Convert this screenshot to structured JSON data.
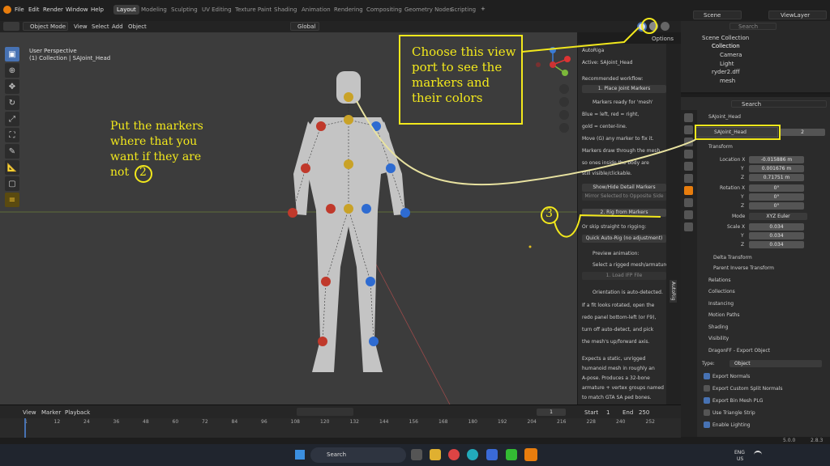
{
  "topbar": {
    "menus": [
      "File",
      "Edit",
      "Render",
      "Window",
      "Help"
    ],
    "workspaces": [
      "Layout",
      "Modeling",
      "Sculpting",
      "UV Editing",
      "Texture Paint",
      "Shading",
      "Animation",
      "Rendering",
      "Compositing",
      "Geometry Nodes",
      "Scripting"
    ],
    "active_workspace": "Layout",
    "plus": "+",
    "scene": "Scene",
    "view_layer": "ViewLayer"
  },
  "header": {
    "mode": "Object Mode",
    "menus": [
      "View",
      "Select",
      "Add",
      "Object"
    ],
    "transform": "Global",
    "options": "Options"
  },
  "viewport": {
    "view_name": "User Perspective",
    "collection_info": "(1) Collection | SAJoint_Head"
  },
  "npanel": {
    "active": "Active: SAJoint_Head",
    "recommended": "Recommended workflow:",
    "place_btn": "1. Place Joint Markers",
    "ready": "Markers ready for 'mesh'",
    "blue_red": "Blue = left, red = right,",
    "gold": "gold = center-line.",
    "move": "Move (G) any marker to fix it.",
    "draw1": "Markers draw through the mesh,",
    "draw2": "so ones inside the body are",
    "draw3": "still visible/clickable.",
    "autoriga": "AutoRiga",
    "show_hide": "Show/Hide Detail Markers",
    "mirror": "Mirror Selected to Opposite Side",
    "rig_btn": "2. Rig from Markers",
    "or_skip": "Or skip straight to rigging:",
    "quick": "Quick Auto-Rig (no adjustment)",
    "preview": "Preview animation:",
    "select_rigged": "Select a rigged mesh/armature",
    "load_ifp": "1. Load IFP File",
    "orient1": "Orientation is auto-detected.",
    "orient2": "If a fit looks rotated, open the",
    "orient3": "redo panel bottom-left (or F9),",
    "orient4": "turn off auto-detect, and pick",
    "orient5": "the mesh's up/forward axis.",
    "exp1": "Expects a static, unrigged",
    "exp2": "humanoid mesh in roughly an",
    "exp3": "A-pose. Produces a 32-bone",
    "exp4": "armature + vertex groups named",
    "exp5": "to match GTA SA ped bones.",
    "tab_label": "AutoRig"
  },
  "outliner": {
    "search": "Search",
    "scene_collection": "Scene Collection",
    "items": [
      "Collection",
      "Camera",
      "Light",
      "ryder2.dff",
      "mesh"
    ]
  },
  "properties": {
    "search": "Search",
    "object_name": "SAJoint_Head",
    "datablock": "SAJoint_Head",
    "user_count": "2",
    "transform": "Transform",
    "location_x_label": "Location X",
    "y": "Y",
    "z": "Z",
    "loc_x": "-0.015886 m",
    "loc_y": "0.001676 m",
    "loc_z": "0.71751 m",
    "rotation_x_label": "Rotation X",
    "rot_x": "0°",
    "rot_y": "0°",
    "rot_z": "0°",
    "mode_label": "Mode",
    "mode": "XYZ Euler",
    "scale_x_label": "Scale X",
    "scale_x": "0.034",
    "scale_y": "0.034",
    "scale_z": "0.034",
    "delta": "Delta Transform",
    "parent_inverse": "Parent Inverse Transform",
    "sections": [
      "Relations",
      "Collections",
      "Instancing",
      "Motion Paths",
      "Shading",
      "Visibility"
    ],
    "dragonff": "DragonFF - Export Object",
    "type_label": "Type:",
    "type_value": "Object",
    "checks": [
      "Export Normals",
      "Export Custom Split Normals",
      "Export Bin Mesh PLG",
      "Use Triangle Strip",
      "Enable Lighting"
    ],
    "checks_on": [
      true,
      false,
      true,
      false,
      true
    ],
    "version_a": "5.0.0",
    "version_b": "2.8.3"
  },
  "timeline": {
    "menus": [
      "View",
      "Marker",
      "Playback"
    ],
    "current_frame": "1",
    "start_label": "Start",
    "start": "1",
    "end_label": "End",
    "end": "250",
    "ticks": [
      "1",
      "12",
      "24",
      "36",
      "48",
      "60",
      "72",
      "84",
      "96",
      "108",
      "120",
      "132",
      "144",
      "156",
      "168",
      "180",
      "192",
      "204",
      "216",
      "228",
      "240",
      "252"
    ]
  },
  "annotations": {
    "note1": "Choose this view port to see the markers and their colors",
    "note2": "Put the markers where that you want if they are not",
    "num2": "2",
    "num3": "3"
  },
  "taskbar": {
    "search": "Search",
    "lang1": "ENG",
    "lang2": "US"
  },
  "colors": {
    "accent": "#4772b3",
    "annotation": "#f2e81c",
    "marker_red": "#c0392b",
    "marker_blue": "#2e6bd1",
    "marker_gold": "#c9a227"
  }
}
